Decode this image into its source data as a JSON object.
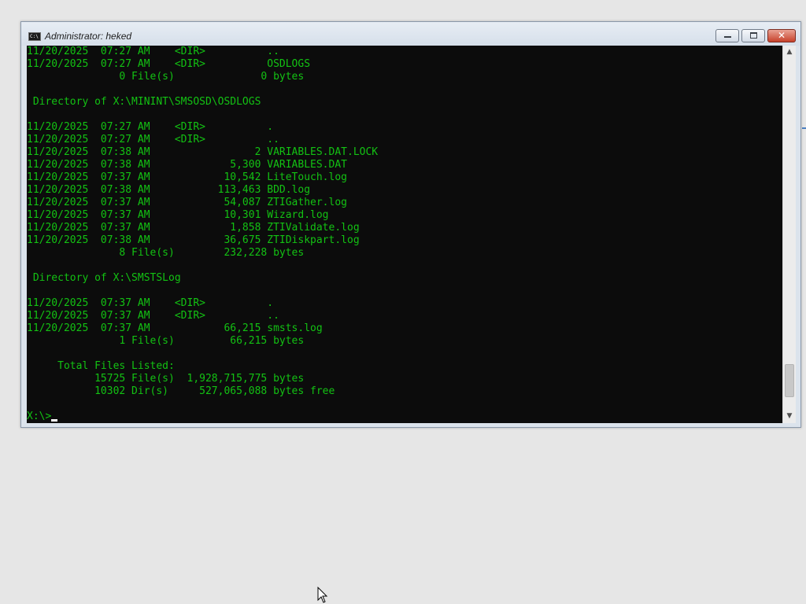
{
  "window": {
    "title": "Administrator: heked",
    "icon": "console-icon",
    "controls": {
      "minimize": "minimize-icon",
      "maximize": "maximize-icon",
      "close": "close-icon",
      "close_glyph": "✕"
    }
  },
  "console": {
    "lines": [
      "11/20/2025  07:27 AM    <DIR>          ..",
      "11/20/2025  07:27 AM    <DIR>          OSDLOGS",
      "               0 File(s)              0 bytes",
      "",
      " Directory of X:\\MININT\\SMSOSD\\OSDLOGS",
      "",
      "11/20/2025  07:27 AM    <DIR>          .",
      "11/20/2025  07:27 AM    <DIR>          ..",
      "11/20/2025  07:38 AM                 2 VARIABLES.DAT.LOCK",
      "11/20/2025  07:38 AM             5,300 VARIABLES.DAT",
      "11/20/2025  07:37 AM            10,542 LiteTouch.log",
      "11/20/2025  07:38 AM           113,463 BDD.log",
      "11/20/2025  07:37 AM            54,087 ZTIGather.log",
      "11/20/2025  07:37 AM            10,301 Wizard.log",
      "11/20/2025  07:37 AM             1,858 ZTIValidate.log",
      "11/20/2025  07:38 AM            36,675 ZTIDiskpart.log",
      "               8 File(s)        232,228 bytes",
      "",
      " Directory of X:\\SMSTSLog",
      "",
      "11/20/2025  07:37 AM    <DIR>          .",
      "11/20/2025  07:37 AM    <DIR>          ..",
      "11/20/2025  07:37 AM            66,215 smsts.log",
      "               1 File(s)         66,215 bytes",
      "",
      "     Total Files Listed:",
      "           15725 File(s)  1,928,715,775 bytes",
      "           10302 Dir(s)     527,065,088 bytes free",
      ""
    ],
    "prompt": "X:\\>",
    "text_color": "#13c213",
    "background": "#0c0c0c"
  },
  "scrollbar": {
    "up_arrow": "▲",
    "down_arrow": "▼",
    "position": 0.96
  },
  "pointer": {
    "icon": "mouse-pointer-icon"
  }
}
